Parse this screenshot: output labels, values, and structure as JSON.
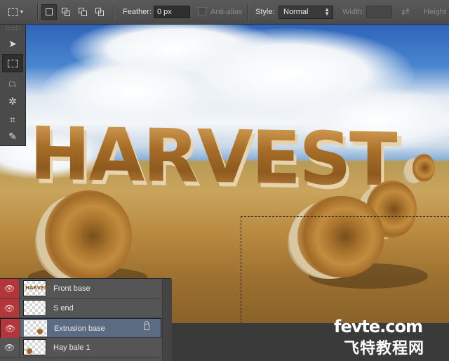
{
  "options_bar": {
    "feather_label": "Feather:",
    "feather_value": "0 px",
    "antialias_label": "Anti-alias",
    "style_label": "Style:",
    "style_value": "Normal",
    "width_label": "Width:",
    "width_value": "",
    "height_label": "Height"
  },
  "canvas": {
    "headline": "HARVEST"
  },
  "tools": [
    "move-tool",
    "marquee-tool",
    "lasso-tool",
    "magic-wand-tool",
    "crop-tool",
    "eyedropper-tool"
  ],
  "layers": {
    "items": [
      {
        "name": "Front base",
        "visible": true,
        "selected": false,
        "thumb": "HARVEST"
      },
      {
        "name": "S end",
        "visible": true,
        "selected": false,
        "thumb": ""
      },
      {
        "name": "Extrusion base",
        "visible": true,
        "selected": true,
        "thumb": ""
      },
      {
        "name": "Hay bale 1",
        "visible": true,
        "selected": false,
        "thumb": ""
      }
    ]
  },
  "watermark": {
    "line1": "fevte.com",
    "line2": "飞特教程网"
  },
  "colors": {
    "visibility_red": "#b3363a",
    "selected_layer": "#5b6b82",
    "panel_bg": "#535353"
  }
}
